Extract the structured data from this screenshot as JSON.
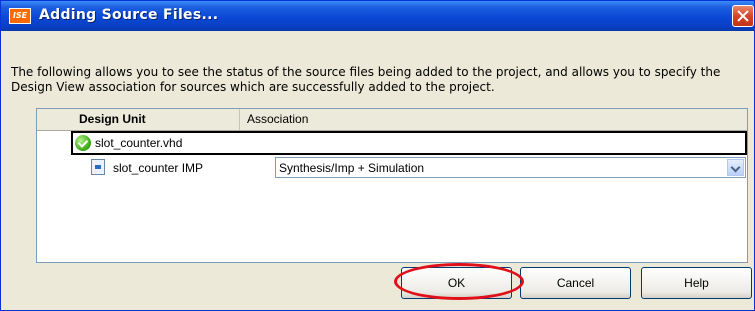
{
  "window": {
    "title": "Adding Source Files...",
    "app_icon_text": "ISE"
  },
  "description": "The following allows you to see the status of the source files being added to the project, and allows you to specify the Design View association for sources which are successfully added to the project.",
  "table": {
    "headers": {
      "design_unit": "Design Unit",
      "association": "Association"
    },
    "rows": [
      {
        "label": "slot_counter.vhd",
        "icon": "check-success-icon"
      },
      {
        "label": "slot_counter IMP",
        "icon": "vhdl-file-icon",
        "association": "Synthesis/Imp + Simulation"
      }
    ]
  },
  "buttons": {
    "ok": "OK",
    "cancel": "Cancel",
    "help": "Help"
  },
  "colors": {
    "titlebar": "#0a48d6",
    "dialog_bg": "#ece9d8",
    "highlight_ring": "#e0101a"
  }
}
